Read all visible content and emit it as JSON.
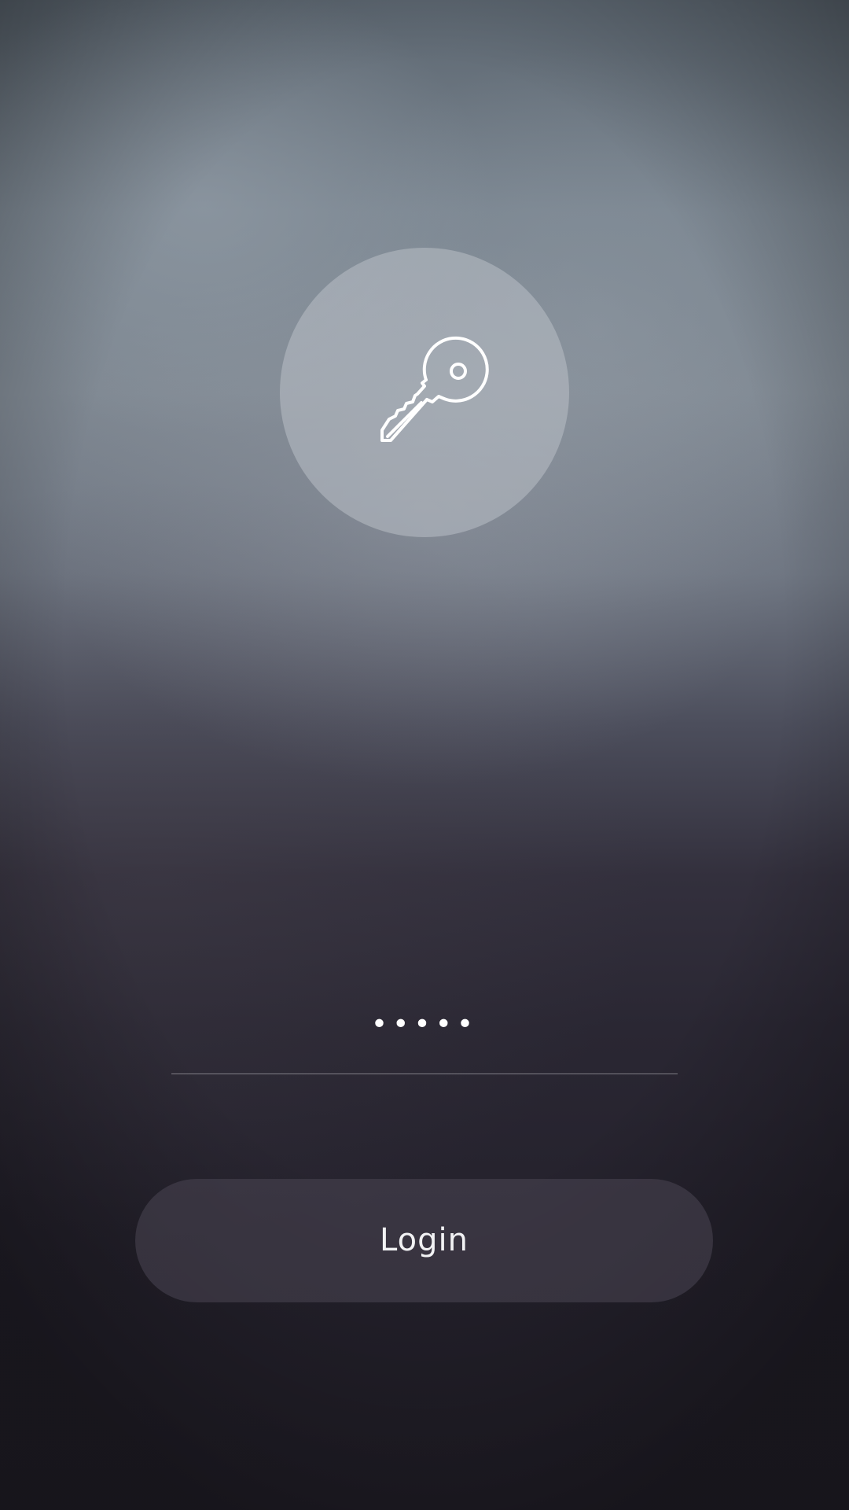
{
  "header": {
    "icon": "key-icon"
  },
  "form": {
    "password_value": "•••••",
    "login_label": "Login"
  },
  "colors": {
    "button_bg": "#3f3a47",
    "text": "#ffffff",
    "circle": "#a4acb3"
  }
}
